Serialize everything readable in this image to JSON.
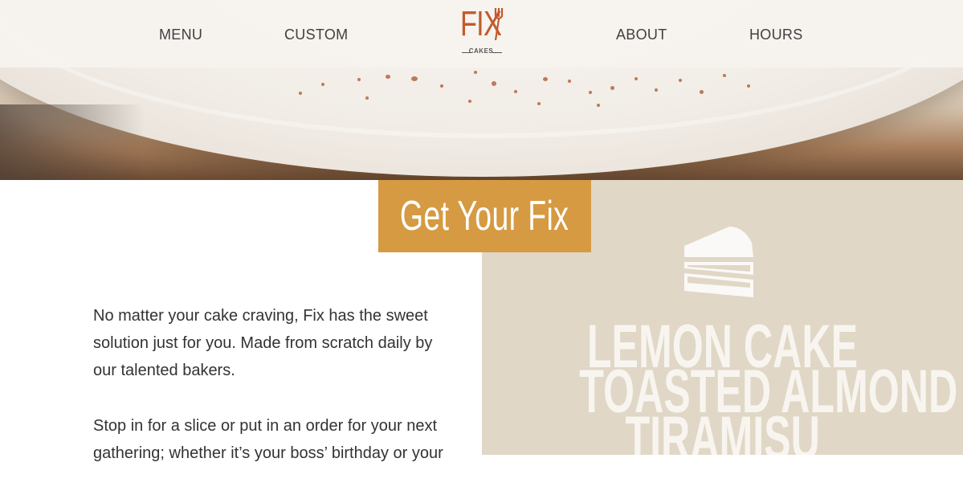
{
  "nav": {
    "menu_label": "MENU",
    "custom_label": "CUSTOM",
    "about_label": "ABOUT",
    "hours_label": "HOURS"
  },
  "logo": {
    "word": "FIX",
    "sub": "CAKES",
    "icon": "fork-icon"
  },
  "banner": {
    "title": "Get Your Fix"
  },
  "intro": {
    "paragraph_1": "No matter your cake craving, Fix has the sweet solution just for you. Made from scratch daily by our talented bakers.",
    "paragraph_2": "Stop in for a slice or put in an order for your next gathering; whether it’s your boss’ birthday or your"
  },
  "flavors": [
    "LEMON CAKE",
    "TOASTED ALMOND",
    "TIRAMISU"
  ],
  "icons": {
    "cake_slice": "cake-slice-icon"
  },
  "colors": {
    "brand_orange": "#c15a2c",
    "banner_gold": "#d69a42",
    "panel_beige": "#e0d7c6",
    "nav_bg": "#f6f3ef",
    "text": "#333333"
  }
}
